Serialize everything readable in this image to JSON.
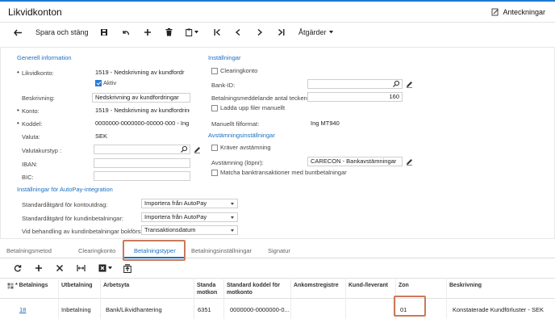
{
  "header": {
    "title": "Likvidkonton",
    "notes_label": "Anteckningar"
  },
  "toolbar": {
    "save_close_label": "Spara och stäng",
    "actions_label": "Åtgärder"
  },
  "general": {
    "section_title": "Generell information",
    "cash_account_label": "Likvidkonto:",
    "cash_account_value": "1519 - Nedskrivning av kundfordr",
    "active_label": "Aktiv",
    "description_label": "Beskrivning:",
    "description_value": "Nedskrivning av kundfordringar",
    "account_label": "Konto:",
    "account_value": "1519 - Nedskrivning av kundfordring",
    "subaccount_label": "Koddel:",
    "subaccount_value": "0000000-0000000-00000-000 - Ing",
    "currency_label": "Valuta:",
    "currency_value": "SEK",
    "rate_type_label": "Valutakurstyp :",
    "rate_type_value": "",
    "iban_label": "IBAN:",
    "iban_value": "",
    "bic_label": "BIC:",
    "bic_value": ""
  },
  "settings": {
    "section_title": "Inställningar",
    "clearing_label": "Clearingkonto",
    "bank_id_label": "Bank-ID:",
    "bank_id_value": "",
    "payment_msg_label": "Betalningsmeddelande antal tecken:",
    "payment_msg_value": "160",
    "upload_label": "Ladda upp filer manuellt",
    "manual_format_label": "Manuellt filformat:",
    "manual_format_value": "Ing MT940"
  },
  "reconciliation": {
    "section_title": "Avstämningsinställningar",
    "requires_label": "Kräver avstämning",
    "numbering_label": "Avstämning (löpnr):",
    "numbering_value": "CARECON - Bankavstämningar",
    "match_label": "Matcha banktransaktioner med buntbetalningar"
  },
  "autopay": {
    "section_title": "Inställningar för AutoPay-integration",
    "withdraw_label": "Standardåtgärd för kontoutdrag:",
    "withdraw_value": "Importera från AutoPay",
    "customer_label": "Standardåtgärd för kundinbetalningar:",
    "customer_value": "Importera från AutoPay",
    "booking_label": "Vid behandling av kundinbetalningar bokförs...",
    "booking_value": "Transaktionsdatum"
  },
  "tabs": [
    {
      "label": "Betalningsmetod"
    },
    {
      "label": "Clearingkonto"
    },
    {
      "label": "Betalningstyper"
    },
    {
      "label": "Betalningsinställningar"
    },
    {
      "label": "Signatur"
    }
  ],
  "grid": {
    "columns": [
      {
        "label": "* Betalnings"
      },
      {
        "label": "Utbetalning"
      },
      {
        "label": "Arbetsyta"
      },
      {
        "label": "Standa motkon"
      },
      {
        "label": "Standard koddel för motkonto"
      },
      {
        "label": "Ankomstregistre"
      },
      {
        "label": "Kund-/leverant"
      },
      {
        "label": "Zon"
      },
      {
        "label": "Beskrivning"
      }
    ],
    "rows": [
      {
        "payment_type": "18",
        "payout": "Inbetalning",
        "workspace": "Bank/Likvidhantering",
        "default_account": "6351",
        "default_subaccount": "0000000-0000000-0...",
        "arrival": "",
        "customer": "",
        "zone": "01",
        "description": "Konstaterade Kundförluster - SEK"
      }
    ]
  },
  "colors": {
    "accent": "#1a6fbf",
    "highlight": "#c97a5a"
  }
}
